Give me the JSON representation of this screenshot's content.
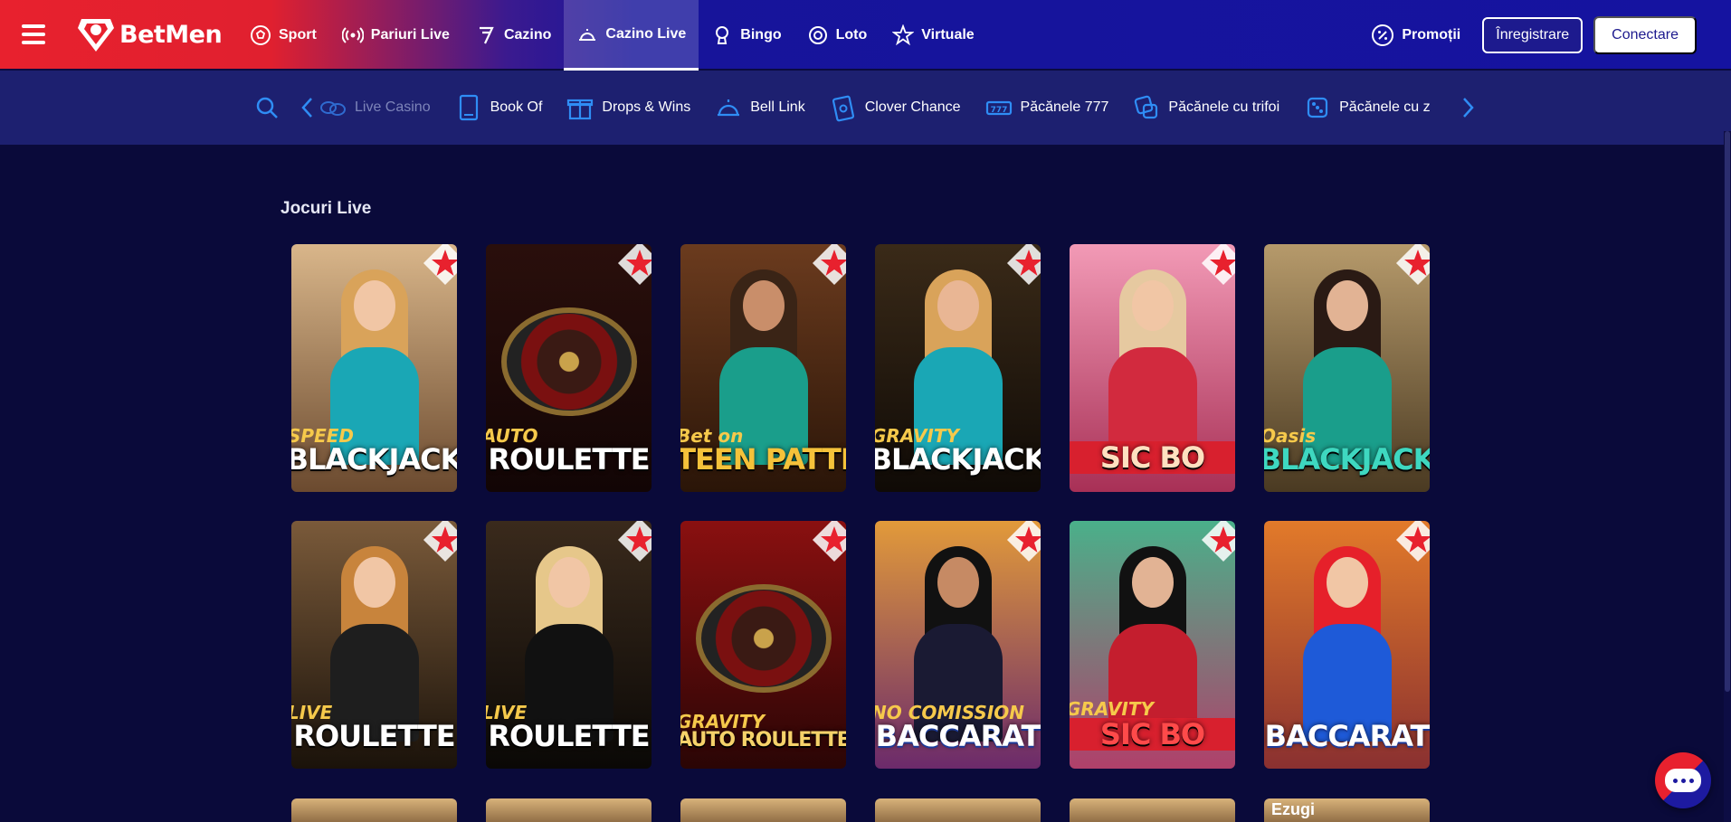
{
  "header": {
    "brand": "BetMen",
    "nav": [
      {
        "label": "Sport",
        "icon": "soccer-ball-icon"
      },
      {
        "label": "Pariuri Live",
        "icon": "live-broadcast-icon"
      },
      {
        "label": "Cazino",
        "icon": "lucky-seven-icon"
      },
      {
        "label": "Cazino Live",
        "icon": "dealer-bell-icon",
        "active": true
      },
      {
        "label": "Bingo",
        "icon": "bingo-trophy-icon"
      },
      {
        "label": "Loto",
        "icon": "lottery-ball-icon"
      },
      {
        "label": "Virtuale",
        "icon": "star-icon"
      }
    ],
    "promotions_label": "Promoții",
    "register_label": "Înregistrare",
    "login_label": "Conectare"
  },
  "categories": [
    {
      "label": "Live Casino",
      "icon": "coins-icon",
      "dim": true
    },
    {
      "label": "Book Of",
      "icon": "book-icon"
    },
    {
      "label": "Drops & Wins",
      "icon": "gift-icon"
    },
    {
      "label": "Bell Link",
      "icon": "bell-icon"
    },
    {
      "label": "Clover Chance",
      "icon": "clover-card-icon"
    },
    {
      "label": "Păcănele 777",
      "icon": "slot-777-icon"
    },
    {
      "label": "Păcănele cu trifoi",
      "icon": "dice-clover-icon"
    },
    {
      "label": "Păcănele cu z",
      "icon": "dice-icon"
    }
  ],
  "main": {
    "section_title": "Jocuri Live",
    "games": [
      {
        "sub": "SPEED",
        "title": "BLACKJACK",
        "theme": "blackjack"
      },
      {
        "sub": "AUTO",
        "title": "ROULETTE",
        "theme": "roulette"
      },
      {
        "sub": "Bet on",
        "title": "TEEN PATTI",
        "theme": "teenpatti"
      },
      {
        "sub": "GRAVITY",
        "title": "BLACKJACK",
        "theme": "gravityblackjack"
      },
      {
        "sub": "",
        "title": "SIC BO",
        "theme": "sicbo"
      },
      {
        "sub": "Oasis",
        "title": "BLACKJACK",
        "theme": "oasis"
      },
      {
        "sub": "LIVE",
        "title": "ROULETTE",
        "theme": "frenchroulette"
      },
      {
        "sub": "LIVE",
        "title": "ROULETTE",
        "theme": "liveroulette"
      },
      {
        "sub": "GRAVITY",
        "title": "AUTO ROULETTE",
        "theme": "gravityroulette"
      },
      {
        "sub": "NO COMISSION",
        "title": "BACCARAT",
        "theme": "baccarat"
      },
      {
        "sub": "GRAVITY",
        "title": "SIC BO",
        "theme": "gravitysicbo"
      },
      {
        "sub": "",
        "title": "BACCARAT",
        "theme": "baccarat2"
      }
    ],
    "row3_labels": [
      "",
      "",
      "",
      "",
      "",
      "Ezugi"
    ]
  },
  "colors": {
    "brand_red": "#e8212e",
    "brand_blue": "#1513a0",
    "page_bg": "#0a0a3a",
    "category_bar": "#1d2070"
  }
}
